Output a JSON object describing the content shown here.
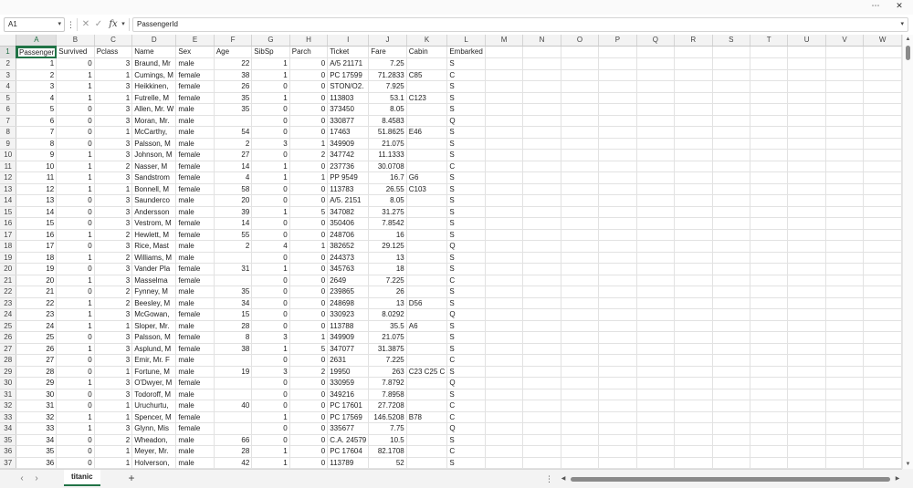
{
  "window": {
    "more_icon": "⋯",
    "close_icon": "✕",
    "colors": {
      "accent": "#217346",
      "header_bg": "#f3f3f3"
    }
  },
  "formula_bar": {
    "name_box": "A1",
    "more_icon": "⋮",
    "cancel_icon": "✕",
    "enter_icon": "✓",
    "fx_icon": "fx",
    "content": "PassengerId"
  },
  "columns": [
    "A",
    "B",
    "C",
    "D",
    "E",
    "F",
    "G",
    "H",
    "I",
    "J",
    "K",
    "L",
    "M",
    "N",
    "O",
    "P",
    "Q",
    "R",
    "S",
    "T",
    "U",
    "V",
    "W"
  ],
  "header_row": [
    "Passenger",
    "Survived",
    "Pclass",
    "Name",
    "Sex",
    "Age",
    "SibSp",
    "Parch",
    "Ticket",
    "Fare",
    "Cabin",
    "Embarked"
  ],
  "rows": [
    [
      "1",
      "0",
      "3",
      "Braund, Mr",
      "male",
      "22",
      "1",
      "0",
      "A/5 21171",
      "7.25",
      "",
      "S"
    ],
    [
      "2",
      "1",
      "1",
      "Cumings, M",
      "female",
      "38",
      "1",
      "0",
      "PC 17599",
      "71.2833",
      "C85",
      "C"
    ],
    [
      "3",
      "1",
      "3",
      "Heikkinen,",
      "female",
      "26",
      "0",
      "0",
      "STON/O2.",
      "7.925",
      "",
      "S"
    ],
    [
      "4",
      "1",
      "1",
      "Futrelle, M",
      "female",
      "35",
      "1",
      "0",
      "113803",
      "53.1",
      "C123",
      "S"
    ],
    [
      "5",
      "0",
      "3",
      "Allen, Mr. W",
      "male",
      "35",
      "0",
      "0",
      "373450",
      "8.05",
      "",
      "S"
    ],
    [
      "6",
      "0",
      "3",
      "Moran, Mr.",
      "male",
      "",
      "0",
      "0",
      "330877",
      "8.4583",
      "",
      "Q"
    ],
    [
      "7",
      "0",
      "1",
      "McCarthy,",
      "male",
      "54",
      "0",
      "0",
      "17463",
      "51.8625",
      "E46",
      "S"
    ],
    [
      "8",
      "0",
      "3",
      "Palsson, M",
      "male",
      "2",
      "3",
      "1",
      "349909",
      "21.075",
      "",
      "S"
    ],
    [
      "9",
      "1",
      "3",
      "Johnson, M",
      "female",
      "27",
      "0",
      "2",
      "347742",
      "11.1333",
      "",
      "S"
    ],
    [
      "10",
      "1",
      "2",
      "Nasser, M",
      "female",
      "14",
      "1",
      "0",
      "237736",
      "30.0708",
      "",
      "C"
    ],
    [
      "11",
      "1",
      "3",
      "Sandstrom",
      "female",
      "4",
      "1",
      "1",
      "PP 9549",
      "16.7",
      "G6",
      "S"
    ],
    [
      "12",
      "1",
      "1",
      "Bonnell, M",
      "female",
      "58",
      "0",
      "0",
      "113783",
      "26.55",
      "C103",
      "S"
    ],
    [
      "13",
      "0",
      "3",
      "Saunderco",
      "male",
      "20",
      "0",
      "0",
      "A/5. 2151",
      "8.05",
      "",
      "S"
    ],
    [
      "14",
      "0",
      "3",
      "Andersson",
      "male",
      "39",
      "1",
      "5",
      "347082",
      "31.275",
      "",
      "S"
    ],
    [
      "15",
      "0",
      "3",
      "Vestrom, M",
      "female",
      "14",
      "0",
      "0",
      "350406",
      "7.8542",
      "",
      "S"
    ],
    [
      "16",
      "1",
      "2",
      "Hewlett, M",
      "female",
      "55",
      "0",
      "0",
      "248706",
      "16",
      "",
      "S"
    ],
    [
      "17",
      "0",
      "3",
      "Rice, Mast",
      "male",
      "2",
      "4",
      "1",
      "382652",
      "29.125",
      "",
      "Q"
    ],
    [
      "18",
      "1",
      "2",
      "Williams, M",
      "male",
      "",
      "0",
      "0",
      "244373",
      "13",
      "",
      "S"
    ],
    [
      "19",
      "0",
      "3",
      "Vander Pla",
      "female",
      "31",
      "1",
      "0",
      "345763",
      "18",
      "",
      "S"
    ],
    [
      "20",
      "1",
      "3",
      "Masselma",
      "female",
      "",
      "0",
      "0",
      "2649",
      "7.225",
      "",
      "C"
    ],
    [
      "21",
      "0",
      "2",
      "Fynney, M",
      "male",
      "35",
      "0",
      "0",
      "239865",
      "26",
      "",
      "S"
    ],
    [
      "22",
      "1",
      "2",
      "Beesley, M",
      "male",
      "34",
      "0",
      "0",
      "248698",
      "13",
      "D56",
      "S"
    ],
    [
      "23",
      "1",
      "3",
      "McGowan,",
      "female",
      "15",
      "0",
      "0",
      "330923",
      "8.0292",
      "",
      "Q"
    ],
    [
      "24",
      "1",
      "1",
      "Sloper, Mr.",
      "male",
      "28",
      "0",
      "0",
      "113788",
      "35.5",
      "A6",
      "S"
    ],
    [
      "25",
      "0",
      "3",
      "Palsson, M",
      "female",
      "8",
      "3",
      "1",
      "349909",
      "21.075",
      "",
      "S"
    ],
    [
      "26",
      "1",
      "3",
      "Asplund, M",
      "female",
      "38",
      "1",
      "5",
      "347077",
      "31.3875",
      "",
      "S"
    ],
    [
      "27",
      "0",
      "3",
      "Emir, Mr. F",
      "male",
      "",
      "0",
      "0",
      "2631",
      "7.225",
      "",
      "C"
    ],
    [
      "28",
      "0",
      "1",
      "Fortune, M",
      "male",
      "19",
      "3",
      "2",
      "19950",
      "263",
      "C23 C25 C",
      "S"
    ],
    [
      "29",
      "1",
      "3",
      "O'Dwyer, M",
      "female",
      "",
      "0",
      "0",
      "330959",
      "7.8792",
      "",
      "Q"
    ],
    [
      "30",
      "0",
      "3",
      "Todoroff, M",
      "male",
      "",
      "0",
      "0",
      "349216",
      "7.8958",
      "",
      "S"
    ],
    [
      "31",
      "0",
      "1",
      "Uruchurtu,",
      "male",
      "40",
      "0",
      "0",
      "PC 17601",
      "27.7208",
      "",
      "C"
    ],
    [
      "32",
      "1",
      "1",
      "Spencer, M",
      "female",
      "",
      "1",
      "0",
      "PC 17569",
      "146.5208",
      "B78",
      "C"
    ],
    [
      "33",
      "1",
      "3",
      "Glynn, Mis",
      "female",
      "",
      "0",
      "0",
      "335677",
      "7.75",
      "",
      "Q"
    ],
    [
      "34",
      "0",
      "2",
      "Wheadon,",
      "male",
      "66",
      "0",
      "0",
      "C.A. 24579",
      "10.5",
      "",
      "S"
    ],
    [
      "35",
      "0",
      "1",
      "Meyer, Mr.",
      "male",
      "28",
      "1",
      "0",
      "PC 17604",
      "82.1708",
      "",
      "C"
    ],
    [
      "36",
      "0",
      "1",
      "Holverson,",
      "male",
      "42",
      "1",
      "0",
      "113789",
      "52",
      "",
      "S"
    ]
  ],
  "sheet_tabs": {
    "prev_icon": "‹",
    "next_icon": "›",
    "active": "titanic",
    "add_icon": "+",
    "more_icon": "⋮"
  },
  "scroll": {
    "up_icon": "▲",
    "down_icon": "▼",
    "left_icon": "◀",
    "right_icon": "▶"
  }
}
